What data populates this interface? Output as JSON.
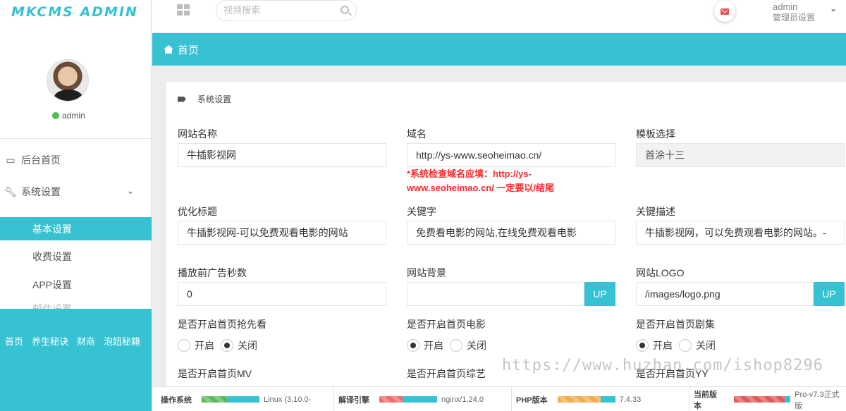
{
  "brand": {
    "logo": "MKCMS ADMIN"
  },
  "colors": {
    "accent": "#36c2d2",
    "warning": "#ff2a2a",
    "online": "#4fbf4f"
  },
  "user": {
    "name": "admin",
    "role_link": "管理员设置"
  },
  "search": {
    "placeholder": "视频搜索"
  },
  "sidebar": {
    "items": [
      {
        "label": "后台首页",
        "icon": "laptop-icon"
      },
      {
        "label": "系统设置",
        "icon": "wrench-icon",
        "expanded": true
      }
    ],
    "sub_items": [
      {
        "label": "基本设置",
        "active": true
      },
      {
        "label": "收费设置"
      },
      {
        "label": "APP设置"
      },
      {
        "label": "邮件设置"
      }
    ],
    "bottom_links": [
      "首页",
      "养生秘诀",
      "财商",
      "泡妞秘籍"
    ]
  },
  "page": {
    "breadcrumb": "首页",
    "section_title": "系统设置"
  },
  "form": {
    "site_name": {
      "label": "网站名称",
      "value": "牛插影视网"
    },
    "domain": {
      "label": "域名",
      "value": "http://ys-www.seoheimao.cn/",
      "warning": "*系统检查域名应填：http://ys-www.seoheimao.cn/ 一定要以/结尾"
    },
    "template": {
      "label": "模板选择",
      "value": "首涂十三"
    },
    "seo_title": {
      "label": "优化标题",
      "value": "牛插影视网-可以免费观看电影的网站"
    },
    "keywords": {
      "label": "关键字",
      "value": "免费看电影的网站,在线免费观看电影"
    },
    "description": {
      "label": "关键描述",
      "value": "牛插影视网，可以免费观看电影的网站。-"
    },
    "ad_seconds": {
      "label": "播放前广告秒数",
      "value": "0"
    },
    "background": {
      "label": "网站背景",
      "value": "",
      "button": "UP"
    },
    "logo": {
      "label": "网站LOGO",
      "value": "/images/logo.png",
      "button": "UP"
    },
    "toggles": [
      {
        "label": "是否开启首页抢先看",
        "on_label": "开启",
        "off_label": "关闭",
        "selected": "off"
      },
      {
        "label": "是否开启首页电影",
        "on_label": "开启",
        "off_label": "关闭",
        "selected": "on"
      },
      {
        "label": "是否开启首页剧集",
        "on_label": "开启",
        "off_label": "关闭",
        "selected": "on"
      },
      {
        "label": "是否开启首页MV"
      },
      {
        "label": "是否开启首页综艺"
      },
      {
        "label": "是否开启首页YY"
      }
    ]
  },
  "watermark": "https://www.huzhan.com/ishop8296",
  "footer": [
    {
      "label": "操作系统",
      "value": "Linux (3.10.0-",
      "fill": 0.45,
      "color": "#5cb85c"
    },
    {
      "label": "解译引擎",
      "value": "nginx/1.24.0",
      "fill": 0.4,
      "color": "#ef6b6b"
    },
    {
      "label": "PHP版本",
      "value": "7.4.33",
      "fill": 0.75,
      "color": "#f0ad4e"
    },
    {
      "label": "当前版本",
      "value": "Pro-v7.3正式版",
      "fill": 0.9,
      "color": "#e05a5a"
    }
  ]
}
